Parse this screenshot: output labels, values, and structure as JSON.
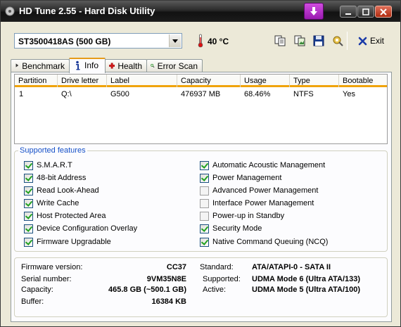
{
  "window": {
    "title": "HD Tune 2.55 - Hard Disk Utility"
  },
  "toolbar": {
    "drive": "ST3500418AS (500 GB)",
    "temperature": "40 °C",
    "exit_label": "Exit"
  },
  "tabs": [
    {
      "label": "Benchmark",
      "icon": "benchmark-icon"
    },
    {
      "label": "Info",
      "icon": "info-icon"
    },
    {
      "label": "Health",
      "icon": "health-cross-icon"
    },
    {
      "label": "Error Scan",
      "icon": "magnifier-icon"
    }
  ],
  "partitions": {
    "headers": [
      "Partition",
      "Drive letter",
      "Label",
      "Capacity",
      "Usage",
      "Type",
      "Bootable"
    ],
    "rows": [
      [
        "1",
        "Q:\\",
        "G500",
        "476937 MB",
        "68.46%",
        "NTFS",
        "Yes"
      ]
    ]
  },
  "features": {
    "title": "Supported features",
    "left": [
      {
        "label": "S.M.A.R.T",
        "checked": true
      },
      {
        "label": "48-bit Address",
        "checked": true
      },
      {
        "label": "Read Look-Ahead",
        "checked": true
      },
      {
        "label": "Write Cache",
        "checked": true
      },
      {
        "label": "Host Protected Area",
        "checked": true
      },
      {
        "label": "Device Configuration Overlay",
        "checked": true
      },
      {
        "label": "Firmware Upgradable",
        "checked": true
      }
    ],
    "right": [
      {
        "label": "Automatic Acoustic Management",
        "checked": true
      },
      {
        "label": "Power Management",
        "checked": true
      },
      {
        "label": "Advanced Power Management",
        "checked": false
      },
      {
        "label": "Interface Power Management",
        "checked": false
      },
      {
        "label": "Power-up in Standby",
        "checked": false
      },
      {
        "label": "Security Mode",
        "checked": true
      },
      {
        "label": "Native Command Queuing (NCQ)",
        "checked": true
      }
    ]
  },
  "info": {
    "firmware_label": "Firmware version:",
    "firmware": "CC37",
    "serial_label": "Serial number:",
    "serial": "9VM35N8E",
    "capacity_label": "Capacity:",
    "capacity": "465.8 GB (~500.1 GB)",
    "buffer_label": "Buffer:",
    "buffer": "16384 KB",
    "standard_label": "Standard:",
    "standard": "ATA/ATAPI-0 - SATA II",
    "supported_label": "Supported:",
    "supported": "UDMA Mode 6 (Ultra ATA/133)",
    "active_label": "Active:",
    "active": "UDMA Mode 5 (Ultra ATA/100)"
  },
  "colors": {
    "accent_orange": "#f0a30a",
    "group_title": "#1550c8",
    "checkbox_tick": "#21a121"
  }
}
